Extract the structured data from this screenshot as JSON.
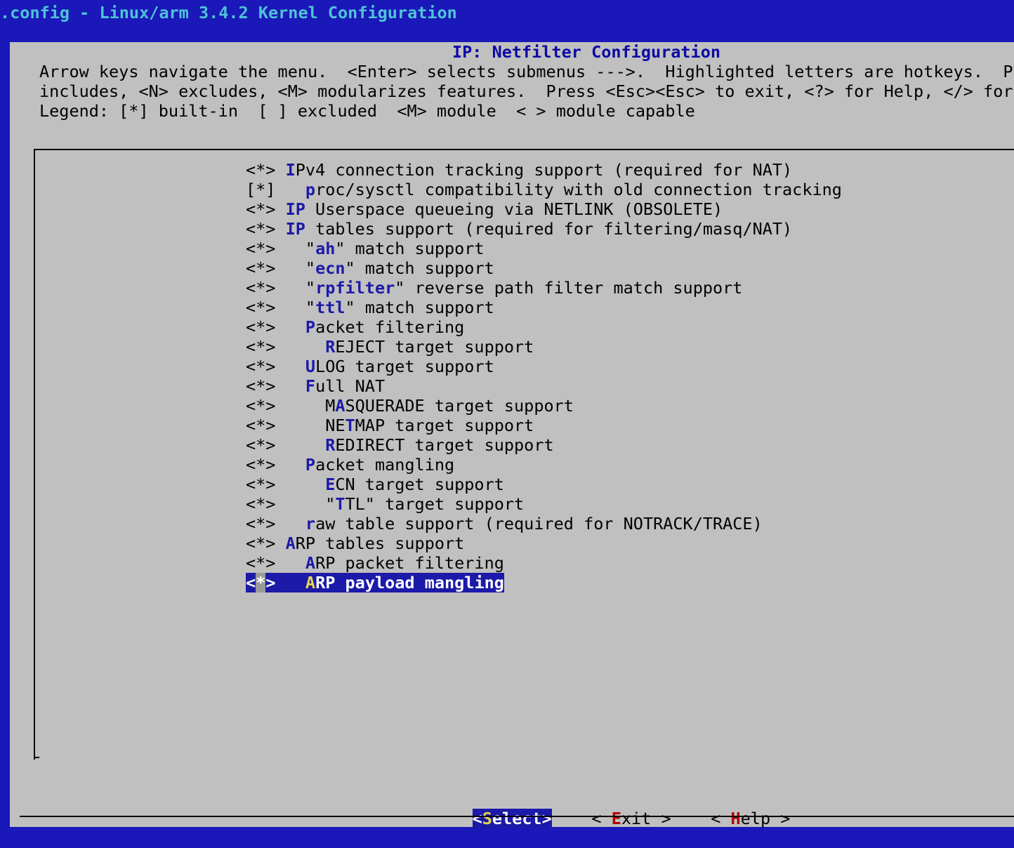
{
  "window_title": ".config - Linux/arm 3.4.2 Kernel Configuration",
  "dialog": {
    "title": "IP: Netfilter Configuration",
    "help_lines": [
      "Arrow keys navigate the menu.  <Enter> selects submenus --->.  Highlighted letters are hotkeys.  Pr",
      "includes, <N> excludes, <M> modularizes features.  Press <Esc><Esc> to exit, <?> for Help, </> for ",
      "Legend: [*] built-in  [ ] excluded  <M> module  < > module capable"
    ]
  },
  "menu_items": [
    {
      "state": "<*>",
      "indent": "",
      "hotkey": "I",
      "rest": "Pv4 connection tracking support (required for NAT)"
    },
    {
      "state": "[*]",
      "indent": "  ",
      "hotkey": "p",
      "rest": "roc/sysctl compatibility with old connection tracking"
    },
    {
      "state": "<*>",
      "indent": "",
      "hotkey": "IP",
      "rest": " Userspace queueing via NETLINK (OBSOLETE)"
    },
    {
      "state": "<*>",
      "indent": "",
      "hotkey": "IP",
      "rest": " tables support (required for filtering/masq/NAT)"
    },
    {
      "state": "<*>",
      "indent": "  ",
      "prefix": "\"",
      "hotkey": "ah",
      "rest": "\" match support"
    },
    {
      "state": "<*>",
      "indent": "  ",
      "prefix": "\"",
      "hotkey": "ecn",
      "rest": "\" match support"
    },
    {
      "state": "<*>",
      "indent": "  ",
      "prefix": "\"",
      "hotkey": "rpfilter",
      "rest": "\" reverse path filter match support"
    },
    {
      "state": "<*>",
      "indent": "  ",
      "prefix": "\"",
      "hotkey": "ttl",
      "rest": "\" match support"
    },
    {
      "state": "<*>",
      "indent": "  ",
      "hotkey": "P",
      "rest": "acket filtering"
    },
    {
      "state": "<*>",
      "indent": "    ",
      "hotkey": "R",
      "rest": "EJECT target support"
    },
    {
      "state": "<*>",
      "indent": "  ",
      "hotkey": "U",
      "rest": "LOG target support"
    },
    {
      "state": "<*>",
      "indent": "  ",
      "hotkey": "F",
      "rest": "ull NAT"
    },
    {
      "state": "<*>",
      "indent": "    ",
      "prefix": "M",
      "hotkey": "A",
      "rest": "SQUERADE target support"
    },
    {
      "state": "<*>",
      "indent": "    ",
      "prefix": "NE",
      "hotkey": "T",
      "rest": "MAP target support"
    },
    {
      "state": "<*>",
      "indent": "    ",
      "hotkey": "R",
      "rest": "EDIRECT target support"
    },
    {
      "state": "<*>",
      "indent": "  ",
      "hotkey": "P",
      "rest": "acket mangling"
    },
    {
      "state": "<*>",
      "indent": "    ",
      "hotkey": "E",
      "rest": "CN target support"
    },
    {
      "state": "<*>",
      "indent": "    ",
      "prefix": "\"",
      "hotkey": "T",
      "rest": "TL\" target support"
    },
    {
      "state": "<*>",
      "indent": "  ",
      "hotkey": "r",
      "rest": "aw table support (required for NOTRACK/TRACE)"
    },
    {
      "state": "<*>",
      "indent": "",
      "hotkey": "A",
      "rest": "RP tables support"
    },
    {
      "state": "<*>",
      "indent": "  ",
      "hotkey": "A",
      "rest": "RP packet filtering"
    },
    {
      "state": "<*>",
      "indent": "  ",
      "hotkey": "A",
      "rest": "RP payload mangling",
      "selected": true
    }
  ],
  "buttons": {
    "select": {
      "left": "<",
      "hotkey": "S",
      "rest": "elect",
      "right": ">"
    },
    "exit": {
      "left": "< ",
      "hotkey": "E",
      "rest": "xit",
      "right": " >"
    },
    "help": {
      "left": "< ",
      "hotkey": "H",
      "rest": "elp",
      "right": " >"
    }
  },
  "colors": {
    "background": "#1a18b8",
    "dialog": "#c0c0c0",
    "title_text": "#4fc3d8",
    "hotkey": "#1c1aa8",
    "selected_hotkey": "#e6d84a",
    "button_hotkey": "#b00000"
  }
}
